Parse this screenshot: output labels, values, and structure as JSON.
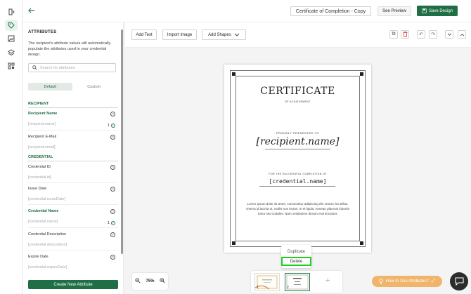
{
  "app": {
    "rail_icons": [
      "flip-icon",
      "tag-icon",
      "image-icon",
      "layers-icon",
      "qr-grid-icon"
    ]
  },
  "topbar": {
    "title_value": "Certificate of Completion - Copy",
    "see_preview": "See Preview",
    "save_design": "Save Design"
  },
  "sidebar": {
    "heading": "ATTRIBUTES",
    "description": "The recipient's attribute values will automatically populate the attributes used in your credential design.",
    "search_placeholder": "Search for attributes",
    "tabs": [
      "Default",
      "Custom"
    ],
    "sections": {
      "recipient": "RECIPIENT",
      "credential": "CREDENTIAL"
    },
    "fields": [
      {
        "label": "Recipient Name",
        "value": "[recipient.name]",
        "count": "1",
        "active": true
      },
      {
        "label": "Recipient E-Mail",
        "value": "[recipient.email]",
        "count": "",
        "active": false
      },
      {
        "label": "Credential ID",
        "value": "[credential.id]",
        "count": "",
        "active": false
      },
      {
        "label": "Issue Date",
        "value": "[credential.issueDate]",
        "count": "",
        "active": false
      },
      {
        "label": "Credential Name",
        "value": "[credential.name]",
        "count": "1",
        "active": true
      },
      {
        "label": "Credential Description",
        "value": "[credential.description]",
        "count": "",
        "active": false
      },
      {
        "label": "Expire Date",
        "value": "[credential.expireDate]",
        "count": "",
        "active": false
      }
    ],
    "create_button": "Create New Attribute"
  },
  "toolbar": {
    "add_text": "Add Text",
    "import_image": "Import Image",
    "add_shapes": "Add Shapes"
  },
  "certificate": {
    "title": "CERTIFICATE",
    "subtitle": "OF ACHIEVEMENT",
    "presented": "PROUDLY PRESENTED TO",
    "name": "[recipient.name]",
    "for_completion": "FOR THE SUCCESSFUL COMPLETION OF",
    "credential": "[credential.name]",
    "lorem": "Lorem ipsum dolor sit amet, consectetur adipiscing elit. Donec leo tellus, viverra id lacinia ut, mollis non lectus. In et ligula. Aenean placerat lobortis tortor sed sodales. Nam vestibulum dictum erat tincidunt."
  },
  "context_menu": {
    "duplicate": "Duplicate",
    "delete": "Delete"
  },
  "bottom": {
    "zoom_level": "75%",
    "pages": [
      "1",
      "2"
    ],
    "selected_page": "2",
    "how_to": "How to Use Attributes?"
  },
  "colors": {
    "brand_green": "#1f6e46",
    "highlight": "#1fcf1f",
    "help_orange": "#f0b46a"
  }
}
